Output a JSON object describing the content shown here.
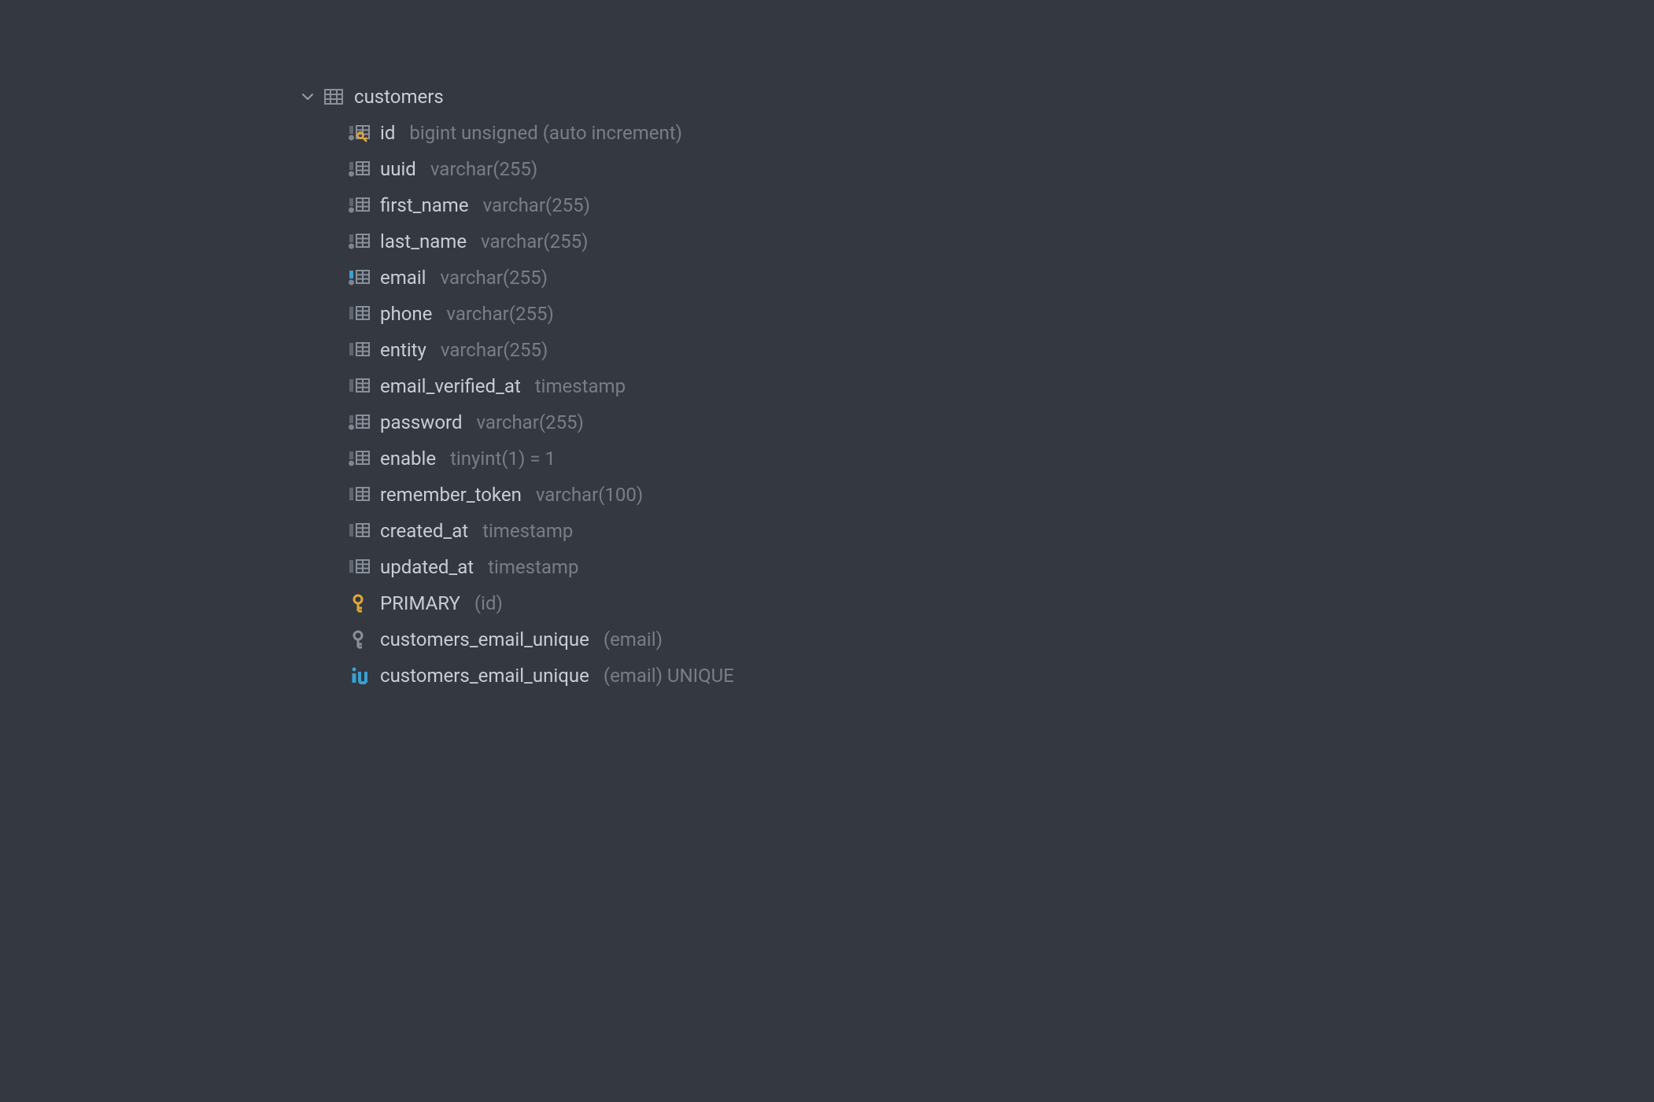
{
  "table": {
    "name": "customers"
  },
  "columns": [
    {
      "icon": "column-pk",
      "name": "id",
      "type": "bigint unsigned (auto increment)"
    },
    {
      "icon": "column-dot",
      "name": "uuid",
      "type": "varchar(255)"
    },
    {
      "icon": "column-dot",
      "name": "first_name",
      "type": "varchar(255)"
    },
    {
      "icon": "column-dot",
      "name": "last_name",
      "type": "varchar(255)"
    },
    {
      "icon": "column-index",
      "name": "email",
      "type": "varchar(255)"
    },
    {
      "icon": "column",
      "name": "phone",
      "type": "varchar(255)"
    },
    {
      "icon": "column",
      "name": "entity",
      "type": "varchar(255)"
    },
    {
      "icon": "column",
      "name": "email_verified_at",
      "type": "timestamp"
    },
    {
      "icon": "column-dot",
      "name": "password",
      "type": "varchar(255)"
    },
    {
      "icon": "column-dot",
      "name": "enable",
      "type": "tinyint(1) = 1"
    },
    {
      "icon": "column",
      "name": "remember_token",
      "type": "varchar(100)"
    },
    {
      "icon": "column",
      "name": "created_at",
      "type": "timestamp"
    },
    {
      "icon": "column",
      "name": "updated_at",
      "type": "timestamp"
    }
  ],
  "indexes": [
    {
      "icon": "key-gold",
      "name": "PRIMARY",
      "detail": "(id)"
    },
    {
      "icon": "key-grey",
      "name": "customers_email_unique",
      "detail": "(email)"
    },
    {
      "icon": "iu-blue",
      "name": "customers_email_unique",
      "detail": "(email) UNIQUE"
    }
  ]
}
